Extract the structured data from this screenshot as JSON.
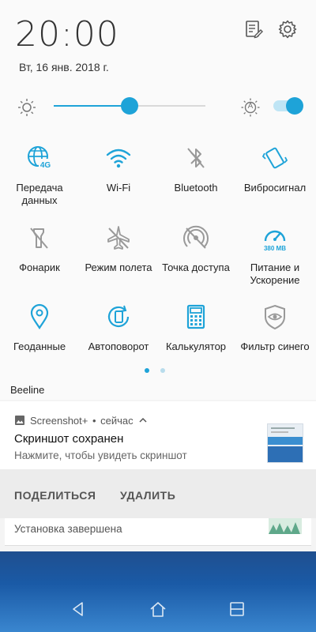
{
  "header": {
    "time": "20:00",
    "date": "Вт, 16 янв. 2018 г.",
    "edit_icon": "edit-list-icon",
    "settings_icon": "gear-icon"
  },
  "brightness": {
    "level": 0.5,
    "auto_label": "A",
    "auto_enabled": true
  },
  "accent_color": "#1ea3d8",
  "tiles": [
    {
      "icon": "mobile-data-4g-icon",
      "label": "Передача\nданных",
      "active": true
    },
    {
      "icon": "wifi-icon",
      "label": "Wi-Fi",
      "active": true
    },
    {
      "icon": "bluetooth-icon",
      "label": "Bluetooth",
      "active": false
    },
    {
      "icon": "vibrate-icon",
      "label": "Вибросигнал",
      "active": true
    },
    {
      "icon": "flashlight-icon",
      "label": "Фонарик",
      "active": false
    },
    {
      "icon": "airplane-icon",
      "label": "Режим полета",
      "active": false
    },
    {
      "icon": "hotspot-icon",
      "label": "Точка доступа",
      "active": false
    },
    {
      "icon": "boost-gauge-icon",
      "label": "Питание и\nУскорение",
      "active": true,
      "badge": "380 MB"
    },
    {
      "icon": "location-icon",
      "label": "Геоданные",
      "active": true
    },
    {
      "icon": "auto-rotate-icon",
      "label": "Автоповорот",
      "active": true
    },
    {
      "icon": "calculator-icon",
      "label": "Калькулятор",
      "active": true
    },
    {
      "icon": "blue-filter-icon",
      "label": "Фильтр синего",
      "active": false
    }
  ],
  "carrier": "Beeline",
  "notification": {
    "app": "Screenshot+",
    "separator": "•",
    "when": "сейчас",
    "title": "Скриншот сохранен",
    "text": "Нажмите, чтобы увидеть скриншот",
    "actions": [
      "ПОДЕЛИТЬСЯ",
      "УДАЛИТЬ"
    ]
  },
  "notification2": {
    "text": "Установка завершена"
  },
  "navbar": {
    "back_icon": "back-icon",
    "home_icon": "home-icon",
    "recents_icon": "recents-icon"
  }
}
